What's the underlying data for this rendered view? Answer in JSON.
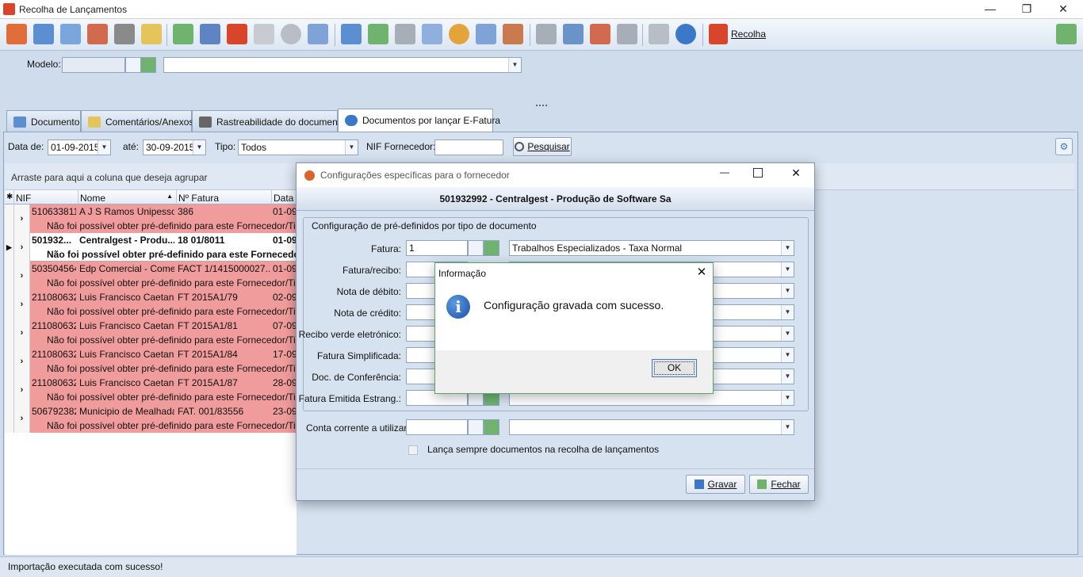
{
  "window": {
    "title": "Recolha de Lançamentos",
    "min": "—",
    "restore": "❐",
    "close": "✕"
  },
  "toolbar": {
    "recolha_label": "Recolha"
  },
  "filter": {
    "modelo_label": "Modelo:",
    "modelo_value": "",
    "modelo_desc": ""
  },
  "tabs": [
    {
      "label": "Documento"
    },
    {
      "label": "Comentários/Anexos"
    },
    {
      "label": "Rastreabilidade do documento"
    },
    {
      "label": "Documentos por lançar E-Fatura"
    }
  ],
  "search": {
    "date_from_label": "Data de:",
    "date_from": "01-09-2015",
    "date_to_label": "até:",
    "date_to": "30-09-2015",
    "tipo_label": "Tipo:",
    "tipo_value": "Todos",
    "nif_label": "NIF Fornecedor:",
    "nif_value": "",
    "search_button": "Pesquisar"
  },
  "grid": {
    "group_hint": "Arraste para aqui a coluna que deseja agrupar",
    "headers": {
      "nif": "NIF",
      "nome": "Nome",
      "fatura": "Nº Fatura",
      "data": "Data E"
    },
    "rows": [
      {
        "nif": "510633811",
        "nome": "A J S Ramos Unipesso...",
        "fatura": "386",
        "data": "01-09",
        "msg": "Não foi possível obter pré-definido para este Fornecedor/Tipo de"
      },
      {
        "nif": "501932...",
        "nome": "Centralgest - Produ...",
        "fatura": "18 01/8011",
        "data": "01-09",
        "msg": "Não foi possível obter pré-definido para este Fornecedor"
      },
      {
        "nif": "503504564",
        "nome": "Edp Comercial - Come...",
        "fatura": "FACT 1/1415000027...",
        "data": "01-09",
        "msg": "Não foi possível obter pré-definido para este Fornecedor/Tipo de"
      },
      {
        "nif": "211080632",
        "nome": "Luis Francisco Caetan...",
        "fatura": "FT 2015A1/79",
        "data": "02-09",
        "msg": "Não foi possível obter pré-definido para este Fornecedor/Tipo de"
      },
      {
        "nif": "211080632",
        "nome": "Luis Francisco Caetan...",
        "fatura": "FT 2015A1/81",
        "data": "07-09",
        "msg": "Não foi possível obter pré-definido para este Fornecedor/Tipo de"
      },
      {
        "nif": "211080632",
        "nome": "Luis Francisco Caetan...",
        "fatura": "FT 2015A1/84",
        "data": "17-09",
        "msg": "Não foi possível obter pré-definido para este Fornecedor/Tipo de"
      },
      {
        "nif": "211080632",
        "nome": "Luis Francisco Caetan...",
        "fatura": "FT 2015A1/87",
        "data": "28-09",
        "msg": "Não foi possível obter pré-definido para este Fornecedor/Tipo de"
      },
      {
        "nif": "506792382",
        "nome": "Municipio de Mealhada",
        "fatura": "FAT. 001/83556",
        "data": "23-09",
        "msg": "Não foi possível obter pré-definido para este Fornecedor/Tipo de"
      }
    ]
  },
  "status": "Importação executada com sucesso!",
  "cfg": {
    "title": "Configurações específicas para o fornecedor",
    "header": "501932992 - Centralgest - Produção de Software Sa",
    "group_title": "Configuração de pré-definidos por tipo de documento",
    "fields": [
      {
        "label": "Fatura:",
        "value": "1",
        "desc": "Trabalhos Especializados - Taxa Normal"
      },
      {
        "label": "Fatura/recibo:",
        "value": "",
        "desc": ""
      },
      {
        "label": "Nota de débito:",
        "value": "",
        "desc": ""
      },
      {
        "label": "Nota de crédito:",
        "value": "",
        "desc": ""
      },
      {
        "label": "Recibo verde eletrónico:",
        "value": "",
        "desc": ""
      },
      {
        "label": "Fatura Simplificada:",
        "value": "",
        "desc": ""
      },
      {
        "label": "Doc. de Conferência:",
        "value": "",
        "desc": ""
      },
      {
        "label": "Fatura Emitida Estrang.:",
        "value": "",
        "desc": ""
      }
    ],
    "conta_label": "Conta corrente a utilizar:",
    "conta_value": "",
    "conta_desc": "",
    "checkbox_label": "Lança sempre documentos na recolha de lançamentos",
    "save_label": "Gravar",
    "close_label": "Fechar"
  },
  "info": {
    "title": "Informação",
    "message": "Configuração gravada com sucesso.",
    "ok": "OK"
  }
}
